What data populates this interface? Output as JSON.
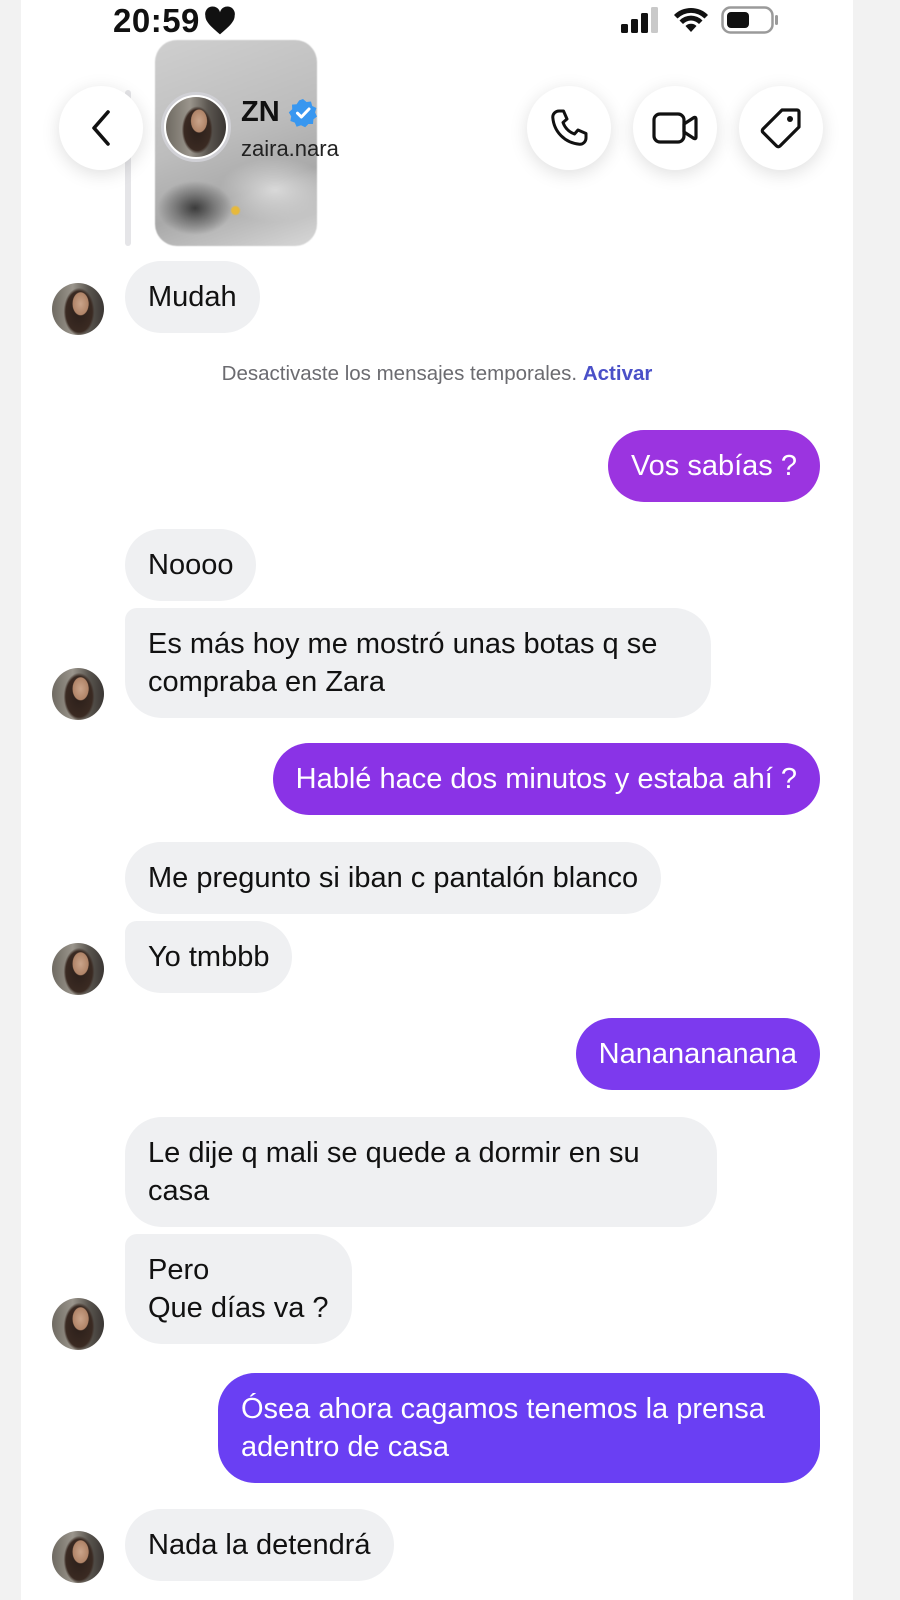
{
  "status_bar": {
    "time": "20:59"
  },
  "header": {
    "name": "ZN",
    "username": "zaira.nara",
    "icons": {
      "back": "chevron-left-icon",
      "call": "phone-icon",
      "video": "video-camera-icon",
      "tag": "tag-icon",
      "verified": "verified-badge-icon"
    }
  },
  "notice": {
    "text": "Desactivaste los mensajes temporales.",
    "link": "Activar"
  },
  "messages": [
    {
      "side": "in",
      "text": "Mudah"
    },
    {
      "side": "out",
      "text": "Vos sabías ?"
    },
    {
      "side": "in",
      "text": "Noooo"
    },
    {
      "side": "in",
      "text": "Es más hoy me mostró unas botas q se compraba en Zara"
    },
    {
      "side": "out",
      "text": "Hablé hace dos minutos y estaba ahí ?"
    },
    {
      "side": "in",
      "text": "Me pregunto si iban c pantalón blanco"
    },
    {
      "side": "in",
      "text": "Yo tmbbb"
    },
    {
      "side": "out",
      "text": "Nananananana"
    },
    {
      "side": "in",
      "text": "Le dije q mali se quede a dormir en su casa"
    },
    {
      "side": "in",
      "text": "Pero\nQue días va ?"
    },
    {
      "side": "out",
      "text": "Ósea ahora cagamos tenemos la prensa adentro de casa"
    },
    {
      "side": "in",
      "text": "Nada la detendrá"
    }
  ],
  "colors": {
    "incoming_bubble": "#eff0f2",
    "outgoing_gradient": [
      "#9b34e0",
      "#8a33e6",
      "#7c3aee",
      "#6a3ff3"
    ],
    "link": "#4a50c8",
    "verified": "#3897f0"
  }
}
